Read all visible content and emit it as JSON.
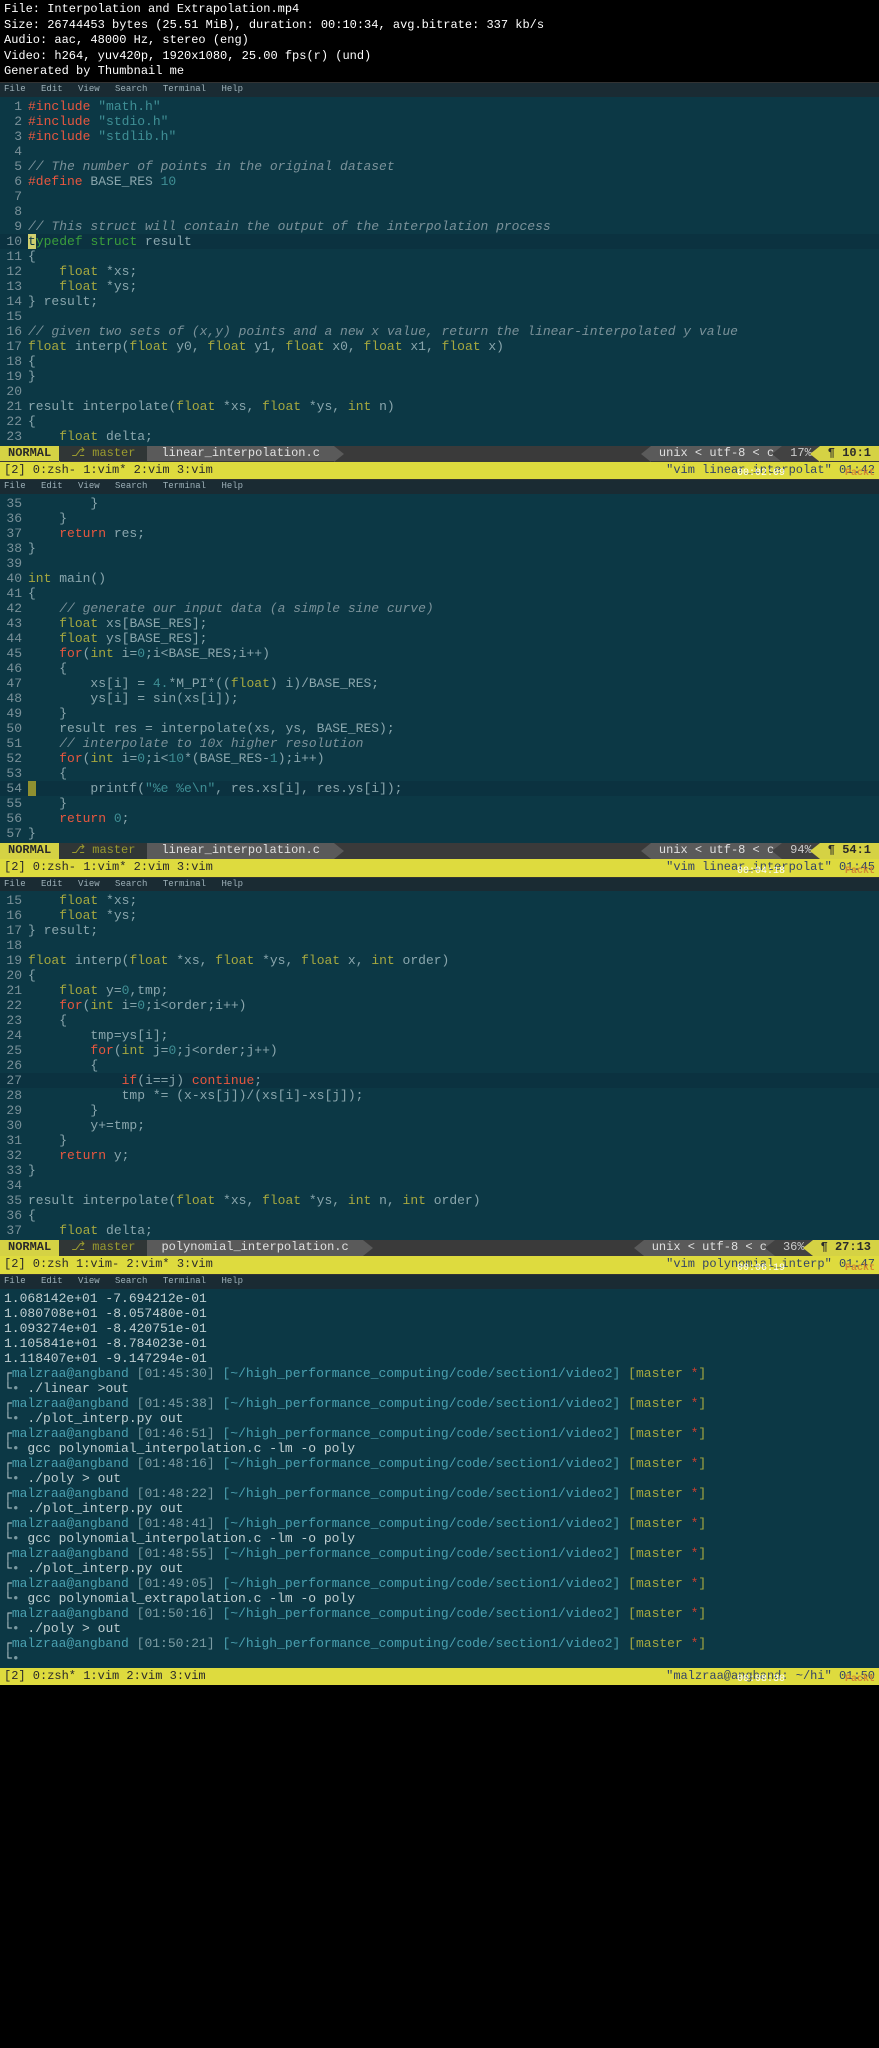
{
  "header": {
    "file": "File: Interpolation and Extrapolation.mp4",
    "size": "Size: 26744453 bytes (25.51 MiB), duration: 00:10:34, avg.bitrate: 337 kb/s",
    "audio": "Audio: aac, 48000 Hz, stereo (eng)",
    "video": "Video: h264, yuv420p, 1920x1080, 25.00 fps(r) (und)",
    "generated": "Generated by Thumbnail me"
  },
  "menu": {
    "file": "File",
    "edit": "Edit",
    "view": "View",
    "search": "Search",
    "terminal": "Terminal",
    "help": "Help"
  },
  "pane1": {
    "lines": [
      {
        "n": "1",
        "segs": [
          {
            "c": "kwred",
            "t": "#include"
          },
          {
            "t": " "
          },
          {
            "c": "string",
            "t": "\"math.h\""
          }
        ]
      },
      {
        "n": "2",
        "segs": [
          {
            "c": "kwred",
            "t": "#include"
          },
          {
            "t": " "
          },
          {
            "c": "string",
            "t": "\"stdio.h\""
          }
        ]
      },
      {
        "n": "3",
        "segs": [
          {
            "c": "kwred",
            "t": "#include"
          },
          {
            "t": " "
          },
          {
            "c": "string",
            "t": "\"stdlib.h\""
          }
        ]
      },
      {
        "n": "4",
        "segs": []
      },
      {
        "n": "5",
        "segs": [
          {
            "c": "comment",
            "t": "// The number of points in the original dataset"
          }
        ]
      },
      {
        "n": "6",
        "segs": [
          {
            "c": "kwred",
            "t": "#define"
          },
          {
            "t": " BASE_RES "
          },
          {
            "c": "num",
            "t": "10"
          }
        ]
      },
      {
        "n": "7",
        "segs": []
      },
      {
        "n": "8",
        "segs": []
      },
      {
        "n": "9",
        "segs": [
          {
            "c": "comment",
            "t": "// This struct will contain the output of the interpolation process"
          }
        ]
      },
      {
        "n": "10",
        "cursor": true,
        "segs": [
          {
            "c": "cursor",
            "t": "t"
          },
          {
            "c": "kwgreen",
            "t": "ypedef"
          },
          {
            "t": " "
          },
          {
            "c": "kwgreen",
            "t": "struct"
          },
          {
            "t": " result"
          }
        ]
      },
      {
        "n": "11",
        "segs": [
          {
            "t": "{"
          }
        ]
      },
      {
        "n": "12",
        "segs": [
          {
            "t": "    "
          },
          {
            "c": "type",
            "t": "float"
          },
          {
            "t": " *xs;"
          }
        ]
      },
      {
        "n": "13",
        "segs": [
          {
            "t": "    "
          },
          {
            "c": "type",
            "t": "float"
          },
          {
            "t": " *ys;"
          }
        ]
      },
      {
        "n": "14",
        "segs": [
          {
            "t": "} result;"
          }
        ]
      },
      {
        "n": "15",
        "segs": []
      },
      {
        "n": "16",
        "segs": [
          {
            "c": "comment",
            "t": "// given two sets of (x,y) points and a new x value, return the linear-interpolated y value"
          }
        ]
      },
      {
        "n": "17",
        "segs": [
          {
            "c": "type",
            "t": "float"
          },
          {
            "t": " interp("
          },
          {
            "c": "type",
            "t": "float"
          },
          {
            "t": " y0, "
          },
          {
            "c": "type",
            "t": "float"
          },
          {
            "t": " y1, "
          },
          {
            "c": "type",
            "t": "float"
          },
          {
            "t": " x0, "
          },
          {
            "c": "type",
            "t": "float"
          },
          {
            "t": " x1, "
          },
          {
            "c": "type",
            "t": "float"
          },
          {
            "t": " x)"
          }
        ]
      },
      {
        "n": "18",
        "segs": [
          {
            "t": "{"
          }
        ]
      },
      {
        "n": "19",
        "segs": [
          {
            "t": "}"
          }
        ]
      },
      {
        "n": "20",
        "segs": []
      },
      {
        "n": "21",
        "segs": [
          {
            "t": "result interpolate("
          },
          {
            "c": "type",
            "t": "float"
          },
          {
            "t": " *xs, "
          },
          {
            "c": "type",
            "t": "float"
          },
          {
            "t": " *ys, "
          },
          {
            "c": "type",
            "t": "int"
          },
          {
            "t": " n)"
          }
        ]
      },
      {
        "n": "22",
        "segs": [
          {
            "t": "{"
          }
        ]
      },
      {
        "n": "23",
        "segs": [
          {
            "t": "    "
          },
          {
            "c": "type",
            "t": "float"
          },
          {
            "t": " delta;"
          }
        ]
      }
    ],
    "status": {
      "mode": "NORMAL",
      "branch": "master",
      "file": "linear_interpolation.c",
      "enc": "unix",
      "utf": "utf-8",
      "lang": "c",
      "pct": "17%",
      "pos": "10:1"
    },
    "tmux": {
      "left": "[2] 0:zsh- 1:vim* 2:vim  3:vim",
      "right": "\"vim linear_interpolat\" 01:42"
    },
    "ts": "00:02:09",
    "wm": "Packt"
  },
  "pane2": {
    "lines": [
      {
        "n": "35",
        "segs": [
          {
            "t": "        }"
          }
        ]
      },
      {
        "n": "36",
        "segs": [
          {
            "t": "    }"
          }
        ]
      },
      {
        "n": "37",
        "segs": [
          {
            "t": "    "
          },
          {
            "c": "kwred",
            "t": "return"
          },
          {
            "t": " res;"
          }
        ]
      },
      {
        "n": "38",
        "segs": [
          {
            "t": "}"
          }
        ]
      },
      {
        "n": "39",
        "segs": []
      },
      {
        "n": "40",
        "segs": [
          {
            "c": "type",
            "t": "int"
          },
          {
            "t": " main()"
          }
        ]
      },
      {
        "n": "41",
        "segs": [
          {
            "t": "{"
          }
        ]
      },
      {
        "n": "42",
        "segs": [
          {
            "t": "    "
          },
          {
            "c": "comment",
            "t": "// generate our input data (a simple sine curve)"
          }
        ]
      },
      {
        "n": "43",
        "segs": [
          {
            "t": "    "
          },
          {
            "c": "type",
            "t": "float"
          },
          {
            "t": " xs[BASE_RES];"
          }
        ]
      },
      {
        "n": "44",
        "segs": [
          {
            "t": "    "
          },
          {
            "c": "type",
            "t": "float"
          },
          {
            "t": " ys[BASE_RES];"
          }
        ]
      },
      {
        "n": "45",
        "segs": [
          {
            "t": "    "
          },
          {
            "c": "kwred",
            "t": "for"
          },
          {
            "t": "("
          },
          {
            "c": "type",
            "t": "int"
          },
          {
            "t": " i="
          },
          {
            "c": "num",
            "t": "0"
          },
          {
            "t": ";i<BASE_RES;i++)"
          }
        ]
      },
      {
        "n": "46",
        "segs": [
          {
            "t": "    {"
          }
        ]
      },
      {
        "n": "47",
        "segs": [
          {
            "t": "        xs[i] = "
          },
          {
            "c": "num",
            "t": "4."
          },
          {
            "t": "*M_PI*(("
          },
          {
            "c": "type",
            "t": "float"
          },
          {
            "t": ") i)/BASE_RES;"
          }
        ]
      },
      {
        "n": "48",
        "segs": [
          {
            "t": "        ys[i] = sin(xs[i]);"
          }
        ]
      },
      {
        "n": "49",
        "segs": [
          {
            "t": "    }"
          }
        ]
      },
      {
        "n": "50",
        "segs": [
          {
            "t": "    result res = interpolate(xs, ys, BASE_RES);"
          }
        ]
      },
      {
        "n": "51",
        "segs": [
          {
            "t": "    "
          },
          {
            "c": "comment",
            "t": "// interpolate to 10x higher resolution"
          }
        ]
      },
      {
        "n": "52",
        "segs": [
          {
            "t": "    "
          },
          {
            "c": "kwred",
            "t": "for"
          },
          {
            "t": "("
          },
          {
            "c": "type",
            "t": "int"
          },
          {
            "t": " i="
          },
          {
            "c": "num",
            "t": "0"
          },
          {
            "t": ";i<"
          },
          {
            "c": "num",
            "t": "10"
          },
          {
            "t": "*(BASE_RES-"
          },
          {
            "c": "num",
            "t": "1"
          },
          {
            "t": ");i++)"
          }
        ]
      },
      {
        "n": "53",
        "segs": [
          {
            "t": "    {"
          }
        ]
      },
      {
        "n": "54",
        "cursor": true,
        "segs": [
          {
            "c": "hl-cursor",
            "t": " "
          },
          {
            "t": "       printf("
          },
          {
            "c": "string",
            "t": "\"%e %e\\n\""
          },
          {
            "t": ", res.xs[i], res.ys[i]);"
          }
        ]
      },
      {
        "n": "55",
        "segs": [
          {
            "t": "    }"
          }
        ]
      },
      {
        "n": "56",
        "segs": [
          {
            "t": "    "
          },
          {
            "c": "kwred",
            "t": "return"
          },
          {
            "t": " "
          },
          {
            "c": "num",
            "t": "0"
          },
          {
            "t": ";"
          }
        ]
      },
      {
        "n": "57",
        "segs": [
          {
            "t": "}"
          }
        ]
      }
    ],
    "status": {
      "mode": "NORMAL",
      "branch": "master",
      "file": "linear_interpolation.c",
      "enc": "unix",
      "utf": "utf-8",
      "lang": "c",
      "pct": "94%",
      "pos": "54:1"
    },
    "tmux": {
      "left": "[2] 0:zsh- 1:vim* 2:vim  3:vim",
      "right": "\"vim linear_interpolat\" 01:45"
    },
    "ts": "00:04:18",
    "wm": "Packt"
  },
  "pane3": {
    "lines": [
      {
        "n": "15",
        "segs": [
          {
            "t": "    "
          },
          {
            "c": "type",
            "t": "float"
          },
          {
            "t": " *xs;"
          }
        ]
      },
      {
        "n": "16",
        "segs": [
          {
            "t": "    "
          },
          {
            "c": "type",
            "t": "float"
          },
          {
            "t": " *ys;"
          }
        ]
      },
      {
        "n": "17",
        "segs": [
          {
            "t": "} result;"
          }
        ]
      },
      {
        "n": "18",
        "segs": []
      },
      {
        "n": "19",
        "segs": [
          {
            "c": "type",
            "t": "float"
          },
          {
            "t": " interp("
          },
          {
            "c": "type",
            "t": "float"
          },
          {
            "t": " *xs, "
          },
          {
            "c": "type",
            "t": "float"
          },
          {
            "t": " *ys, "
          },
          {
            "c": "type",
            "t": "float"
          },
          {
            "t": " x, "
          },
          {
            "c": "type",
            "t": "int"
          },
          {
            "t": " order)"
          }
        ]
      },
      {
        "n": "20",
        "segs": [
          {
            "t": "{"
          }
        ]
      },
      {
        "n": "21",
        "segs": [
          {
            "t": "    "
          },
          {
            "c": "type",
            "t": "float"
          },
          {
            "t": " y="
          },
          {
            "c": "num",
            "t": "0"
          },
          {
            "t": ",tmp;"
          }
        ]
      },
      {
        "n": "22",
        "segs": [
          {
            "t": "    "
          },
          {
            "c": "kwred",
            "t": "for"
          },
          {
            "t": "("
          },
          {
            "c": "type",
            "t": "int"
          },
          {
            "t": " i="
          },
          {
            "c": "num",
            "t": "0"
          },
          {
            "t": ";i<order;i++)"
          }
        ]
      },
      {
        "n": "23",
        "segs": [
          {
            "t": "    {"
          }
        ]
      },
      {
        "n": "24",
        "segs": [
          {
            "t": "        tmp=ys[i];"
          }
        ]
      },
      {
        "n": "25",
        "segs": [
          {
            "t": "        "
          },
          {
            "c": "kwred",
            "t": "for"
          },
          {
            "t": "("
          },
          {
            "c": "type",
            "t": "int"
          },
          {
            "t": " j="
          },
          {
            "c": "num",
            "t": "0"
          },
          {
            "t": ";j<order;j++)"
          }
        ]
      },
      {
        "n": "26",
        "segs": [
          {
            "t": "        {"
          }
        ]
      },
      {
        "n": "27",
        "cursor": true,
        "segs": [
          {
            "t": "            "
          },
          {
            "c": "kwred",
            "t": "if"
          },
          {
            "t": "(i==j) "
          },
          {
            "c": "kwred",
            "t": "continue"
          },
          {
            "t": ";"
          }
        ]
      },
      {
        "n": "28",
        "segs": [
          {
            "t": "            tmp *= (x-xs[j])/(xs[i]-xs[j]);"
          }
        ]
      },
      {
        "n": "29",
        "segs": [
          {
            "t": "        }"
          }
        ]
      },
      {
        "n": "30",
        "segs": [
          {
            "t": "        y+=tmp;"
          }
        ]
      },
      {
        "n": "31",
        "segs": [
          {
            "t": "    }"
          }
        ]
      },
      {
        "n": "32",
        "segs": [
          {
            "t": "    "
          },
          {
            "c": "kwred",
            "t": "return"
          },
          {
            "t": " y;"
          }
        ]
      },
      {
        "n": "33",
        "segs": [
          {
            "t": "}"
          }
        ]
      },
      {
        "n": "34",
        "segs": []
      },
      {
        "n": "35",
        "segs": [
          {
            "t": "result interpolate("
          },
          {
            "c": "type",
            "t": "float"
          },
          {
            "t": " *xs, "
          },
          {
            "c": "type",
            "t": "float"
          },
          {
            "t": " *ys, "
          },
          {
            "c": "type",
            "t": "int"
          },
          {
            "t": " n, "
          },
          {
            "c": "type",
            "t": "int"
          },
          {
            "t": " order)"
          }
        ]
      },
      {
        "n": "36",
        "segs": [
          {
            "t": "{"
          }
        ]
      },
      {
        "n": "37",
        "segs": [
          {
            "t": "    "
          },
          {
            "c": "type",
            "t": "float"
          },
          {
            "t": " delta;"
          }
        ]
      }
    ],
    "status": {
      "mode": "NORMAL",
      "branch": "master",
      "file": "polynomial_interpolation.c",
      "enc": "unix",
      "utf": "utf-8",
      "lang": "c",
      "pct": "36%",
      "pos": "27:13"
    },
    "tmux": {
      "left": "[2] 0:zsh  1:vim- 2:vim* 3:vim",
      "right": "\"vim polynomial_interp\" 01:47"
    },
    "ts": "00:06:19",
    "wm": "Packt"
  },
  "pane4": {
    "output": [
      "1.068142e+01 -7.694212e-01",
      "1.080708e+01 -8.057480e-01",
      "1.093274e+01 -8.420751e-01",
      "1.105841e+01 -8.784023e-01",
      "1.118407e+01 -9.147294e-01"
    ],
    "prompts": [
      {
        "user": "malzraa@angband",
        "time": "[01:45:30]",
        "path": "[~/high_performance_computing/code/section1/video2]",
        "git": "[master *]",
        "cmd": "./linear >out"
      },
      {
        "user": "malzraa@angband",
        "time": "[01:45:38]",
        "path": "[~/high_performance_computing/code/section1/video2]",
        "git": "[master *]",
        "cmd": "./plot_interp.py out"
      },
      {
        "user": "malzraa@angband",
        "time": "[01:46:51]",
        "path": "[~/high_performance_computing/code/section1/video2]",
        "git": "[master *]",
        "cmd": "gcc polynomial_interpolation.c -lm -o poly"
      },
      {
        "user": "malzraa@angband",
        "time": "[01:48:16]",
        "path": "[~/high_performance_computing/code/section1/video2]",
        "git": "[master *]",
        "cmd": "./poly > out"
      },
      {
        "user": "malzraa@angband",
        "time": "[01:48:22]",
        "path": "[~/high_performance_computing/code/section1/video2]",
        "git": "[master *]",
        "cmd": "./plot_interp.py out"
      },
      {
        "user": "malzraa@angband",
        "time": "[01:48:41]",
        "path": "[~/high_performance_computing/code/section1/video2]",
        "git": "[master *]",
        "cmd": "gcc polynomial_interpolation.c -lm -o poly"
      },
      {
        "user": "malzraa@angband",
        "time": "[01:48:55]",
        "path": "[~/high_performance_computing/code/section1/video2]",
        "git": "[master *]",
        "cmd": "./plot_interp.py out"
      },
      {
        "user": "malzraa@angband",
        "time": "[01:49:05]",
        "path": "[~/high_performance_computing/code/section1/video2]",
        "git": "[master *]",
        "cmd": "gcc polynomial_extrapolation.c -lm -o poly"
      },
      {
        "user": "malzraa@angband",
        "time": "[01:50:16]",
        "path": "[~/high_performance_computing/code/section1/video2]",
        "git": "[master *]",
        "cmd": "./poly > out"
      },
      {
        "user": "malzraa@angband",
        "time": "[01:50:21]",
        "path": "[~/high_performance_computing/code/section1/video2]",
        "git": "[master *]",
        "cmd": ""
      }
    ],
    "tmux": {
      "left": "[2] 0:zsh* 1:vim  2:vim  3:vim",
      "right": "\"malzraa@angband: ~/hi\" 01:50"
    },
    "ts": "00:08:30",
    "wm": "Packt"
  }
}
